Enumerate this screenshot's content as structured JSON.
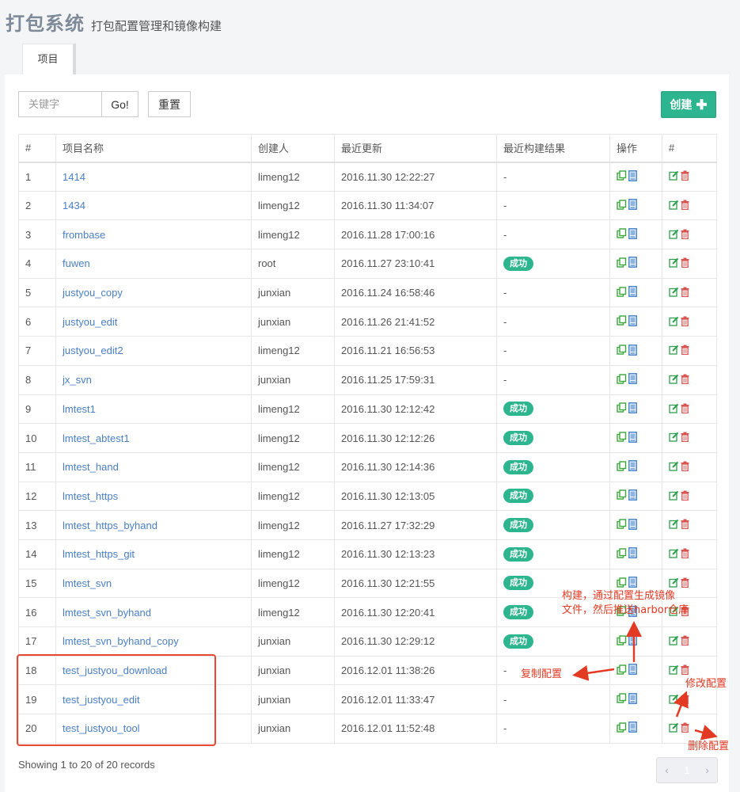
{
  "header": {
    "title": "打包系统",
    "subtitle": "打包配置管理和镜像构建"
  },
  "tabs": [
    {
      "label": "项目"
    }
  ],
  "search": {
    "placeholder": "关键字",
    "go_label": "Go!",
    "reset_label": "重置"
  },
  "create_label": "创建",
  "table": {
    "columns": [
      "#",
      "项目名称",
      "创建人",
      "最近更新",
      "最近构建结果",
      "操作",
      "#"
    ],
    "rows": [
      {
        "id": "1",
        "name": "1414",
        "creator": "limeng12",
        "updated": "2016.11.30 12:22:27",
        "result": "-"
      },
      {
        "id": "2",
        "name": "1434",
        "creator": "limeng12",
        "updated": "2016.11.30 11:34:07",
        "result": "-"
      },
      {
        "id": "3",
        "name": "frombase",
        "creator": "limeng12",
        "updated": "2016.11.28 17:00:16",
        "result": "-"
      },
      {
        "id": "4",
        "name": "fuwen",
        "creator": "root",
        "updated": "2016.11.27 23:10:41",
        "result": "成功"
      },
      {
        "id": "5",
        "name": "justyou_copy",
        "creator": "junxian",
        "updated": "2016.11.24 16:58:46",
        "result": "-"
      },
      {
        "id": "6",
        "name": "justyou_edit",
        "creator": "junxian",
        "updated": "2016.11.26 21:41:52",
        "result": "-"
      },
      {
        "id": "7",
        "name": "justyou_edit2",
        "creator": "limeng12",
        "updated": "2016.11.21 16:56:53",
        "result": "-"
      },
      {
        "id": "8",
        "name": "jx_svn",
        "creator": "junxian",
        "updated": "2016.11.25 17:59:31",
        "result": "-"
      },
      {
        "id": "9",
        "name": "lmtest1",
        "creator": "limeng12",
        "updated": "2016.11.30 12:12:42",
        "result": "成功"
      },
      {
        "id": "10",
        "name": "lmtest_abtest1",
        "creator": "limeng12",
        "updated": "2016.11.30 12:12:26",
        "result": "成功"
      },
      {
        "id": "11",
        "name": "lmtest_hand",
        "creator": "limeng12",
        "updated": "2016.11.30 12:14:36",
        "result": "成功"
      },
      {
        "id": "12",
        "name": "lmtest_https",
        "creator": "limeng12",
        "updated": "2016.11.30 12:13:05",
        "result": "成功"
      },
      {
        "id": "13",
        "name": "lmtest_https_byhand",
        "creator": "limeng12",
        "updated": "2016.11.27 17:32:29",
        "result": "成功"
      },
      {
        "id": "14",
        "name": "lmtest_https_git",
        "creator": "limeng12",
        "updated": "2016.11.30 12:13:23",
        "result": "成功"
      },
      {
        "id": "15",
        "name": "lmtest_svn",
        "creator": "limeng12",
        "updated": "2016.11.30 12:21:55",
        "result": "成功"
      },
      {
        "id": "16",
        "name": "lmtest_svn_byhand",
        "creator": "limeng12",
        "updated": "2016.11.30 12:20:41",
        "result": "成功"
      },
      {
        "id": "17",
        "name": "lmtest_svn_byhand_copy",
        "creator": "junxian",
        "updated": "2016.11.30 12:29:12",
        "result": "成功"
      },
      {
        "id": "18",
        "name": "test_justyou_download",
        "creator": "junxian",
        "updated": "2016.12.01 11:38:26",
        "result": "-"
      },
      {
        "id": "19",
        "name": "test_justyou_edit",
        "creator": "junxian",
        "updated": "2016.12.01 11:33:47",
        "result": "-"
      },
      {
        "id": "20",
        "name": "test_justyou_tool",
        "creator": "junxian",
        "updated": "2016.12.01 11:52:48",
        "result": "-"
      }
    ]
  },
  "footer": {
    "records_text": "Showing 1 to 20 of 20 records"
  },
  "pagination": {
    "prev": "‹",
    "page": "1",
    "next": "›"
  },
  "annotations": {
    "build": "构建，通过配置生成镜像\n文件，然后推送harbor仓库",
    "copy": "复制配置",
    "edit": "修改配置",
    "delete": "删除配置"
  },
  "icons": {
    "copy": "copy-icon",
    "build": "build-icon",
    "edit": "edit-icon",
    "delete": "trash-icon"
  },
  "colors": {
    "accent": "#2cb58e",
    "link": "#4a7fc6",
    "copy_icon": "#3aa83a",
    "build_icon": "#3b7dc8",
    "edit_icon": "#2e9e4f",
    "delete_icon": "#d9534f",
    "annotation": "#e23a23"
  }
}
